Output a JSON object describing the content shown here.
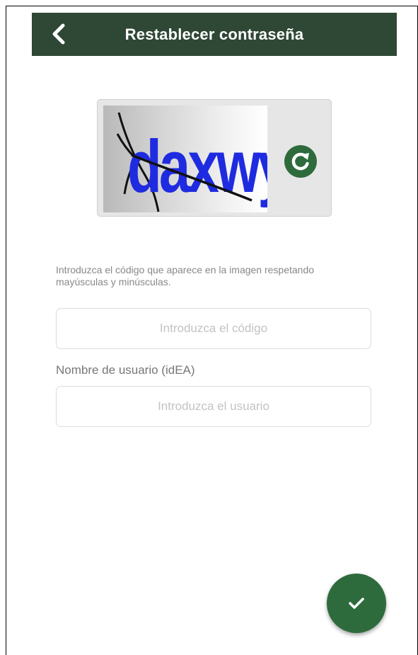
{
  "header": {
    "title": "Restablecer contraseña",
    "back_icon": "chevron-left-icon"
  },
  "captcha": {
    "text": "daxwy",
    "refresh_icon": "refresh-icon",
    "refresh_color": "#2e6b3c"
  },
  "form": {
    "hint": "Introduzca el código que aparece en la imagen respetando mayúsculas y minúsculas.",
    "code_placeholder": "Introduzca el código",
    "code_value": "",
    "user_label": "Nombre de usuario (idEA)",
    "user_placeholder": "Introduzca el usuario",
    "user_value": ""
  },
  "submit": {
    "icon": "checkmark-icon",
    "color": "#2e6b3c"
  },
  "colors": {
    "header_bg": "#2f4735",
    "captcha_text": "#1f2be0"
  }
}
